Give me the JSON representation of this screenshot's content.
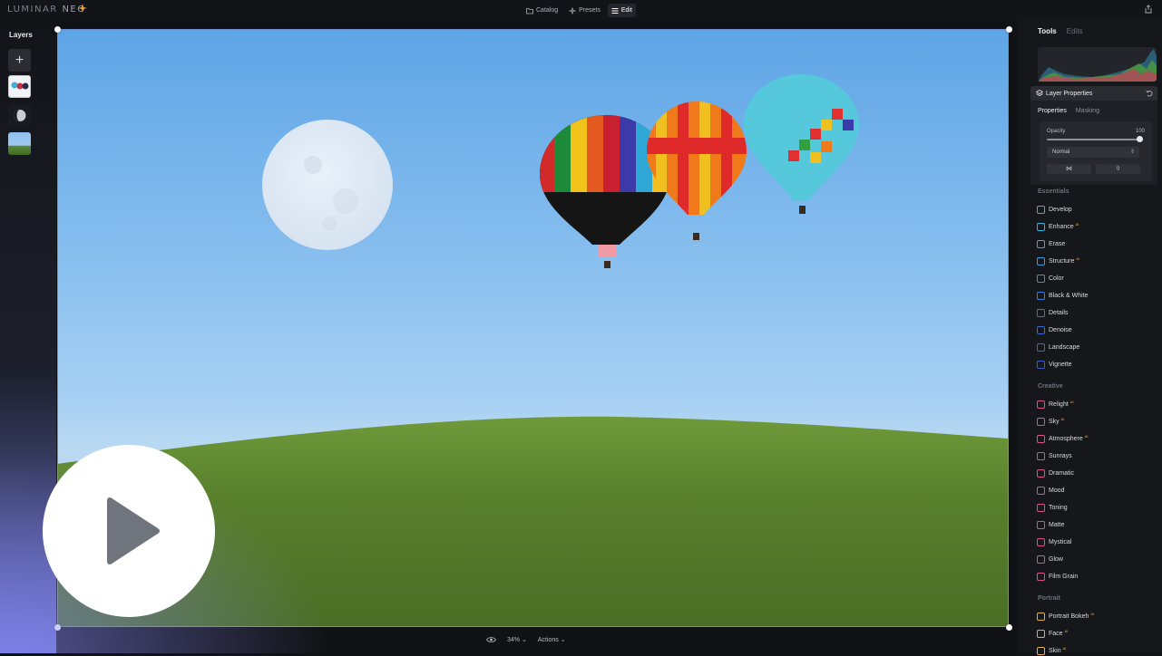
{
  "app": {
    "logo_a": "LUMINAR",
    "logo_b": "NEO"
  },
  "nav": {
    "items": [
      {
        "label": "Catalog",
        "active": false
      },
      {
        "label": "Presets",
        "active": false
      },
      {
        "label": "Edit",
        "active": true
      }
    ]
  },
  "layers": {
    "title": "Layers",
    "add_label": "+"
  },
  "bottom": {
    "zoom": "34%",
    "actions": "Actions"
  },
  "right": {
    "tabs": [
      {
        "label": "Tools",
        "active": true
      },
      {
        "label": "Edits",
        "active": false
      }
    ],
    "layer_properties": {
      "title": "Layer Properties",
      "subtabs": [
        {
          "label": "Properties",
          "active": true
        },
        {
          "label": "Masking",
          "active": false
        }
      ],
      "opacity_label": "Opacity",
      "opacity_value": "100",
      "opacity_level": 1.0,
      "blend_mode": "Normal",
      "flip_h": "⋈",
      "flip_v": "⇳"
    },
    "sections": [
      {
        "title": "Essentials",
        "tools": [
          {
            "label": "Develop",
            "color": "#2ab6e6",
            "ai": ""
          },
          {
            "label": "Enhance",
            "color": "#2ab6e6",
            "ai": "AI"
          },
          {
            "label": "Erase",
            "color": "#4aa3e0",
            "ai": ""
          },
          {
            "label": "Structure",
            "color": "#3a9ee0",
            "ai": "AI"
          },
          {
            "label": "Color",
            "color": "#3a90e0",
            "ai": ""
          },
          {
            "label": "Black & White",
            "color": "#3a7ee0",
            "ai": ""
          },
          {
            "label": "Details",
            "color": "#3a72e0",
            "ai": ""
          },
          {
            "label": "Denoise",
            "color": "#3a68d8",
            "ai": ""
          },
          {
            "label": "Landscape",
            "color": "#3a68d8",
            "ai": ""
          },
          {
            "label": "Vignette",
            "color": "#3a5ed0",
            "ai": ""
          }
        ]
      },
      {
        "title": "Creative",
        "tools": [
          {
            "label": "Relight",
            "color": "#e0508a",
            "ai": "AI"
          },
          {
            "label": "Sky",
            "color": "#e0508a",
            "ai": "AI"
          },
          {
            "label": "Atmosphere",
            "color": "#e0508a",
            "ai": "AI"
          },
          {
            "label": "Sunrays",
            "color": "#e0508a",
            "ai": ""
          },
          {
            "label": "Dramatic",
            "color": "#e0508a",
            "ai": ""
          },
          {
            "label": "Mood",
            "color": "#e0508a",
            "ai": ""
          },
          {
            "label": "Toning",
            "color": "#e0508a",
            "ai": ""
          },
          {
            "label": "Matte",
            "color": "#e0508a",
            "ai": ""
          },
          {
            "label": "Mystical",
            "color": "#e0508a",
            "ai": ""
          },
          {
            "label": "Glow",
            "color": "#e0508a",
            "ai": ""
          },
          {
            "label": "Film Grain",
            "color": "#e0508a",
            "ai": ""
          }
        ]
      },
      {
        "title": "Portrait",
        "tools": [
          {
            "label": "Portrait Bokeh",
            "color": "#e0b24a",
            "ai": "AI"
          },
          {
            "label": "Face",
            "color": "#e0b24a",
            "ai": "AI"
          },
          {
            "label": "Skin",
            "color": "#e0b24a",
            "ai": "AI"
          }
        ]
      }
    ]
  }
}
